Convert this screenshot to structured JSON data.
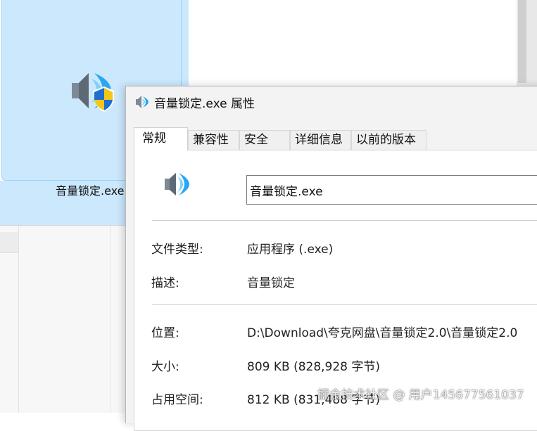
{
  "explorer": {
    "file_name": "音量锁定.exe"
  },
  "dialog": {
    "title": "音量锁定.exe 属性",
    "tabs": [
      {
        "label": "常规",
        "active": true
      },
      {
        "label": "兼容性",
        "active": false
      },
      {
        "label": "安全",
        "active": false
      },
      {
        "label": "详细信息",
        "active": false
      },
      {
        "label": "以前的版本",
        "active": false
      }
    ],
    "general": {
      "file_name_value": "音量锁定.exe",
      "type_label": "文件类型:",
      "type_value": "应用程序 (.exe)",
      "desc_label": "描述:",
      "desc_value": "音量锁定",
      "location_label": "位置:",
      "location_value": "D:\\Download\\夸克网盘\\音量锁定2.0\\音量锁定2.0",
      "size_label": "大小:",
      "size_value": "809 KB (828,928 字节)",
      "disk_size_label": "占用空间:",
      "disk_size_value": "812 KB (831,488 字节)"
    }
  },
  "watermark": "掘金技术社区 @ 用户145677561037",
  "icons": {
    "file_icon": "speaker-shield-icon",
    "title_icon": "speaker-icon",
    "panel_icon": "speaker-icon"
  },
  "colors": {
    "selection_bg": "#cce8fd",
    "speaker_blue": "#29a8f0",
    "shield_blue": "#1f6fd0",
    "shield_yellow": "#f5c518"
  }
}
